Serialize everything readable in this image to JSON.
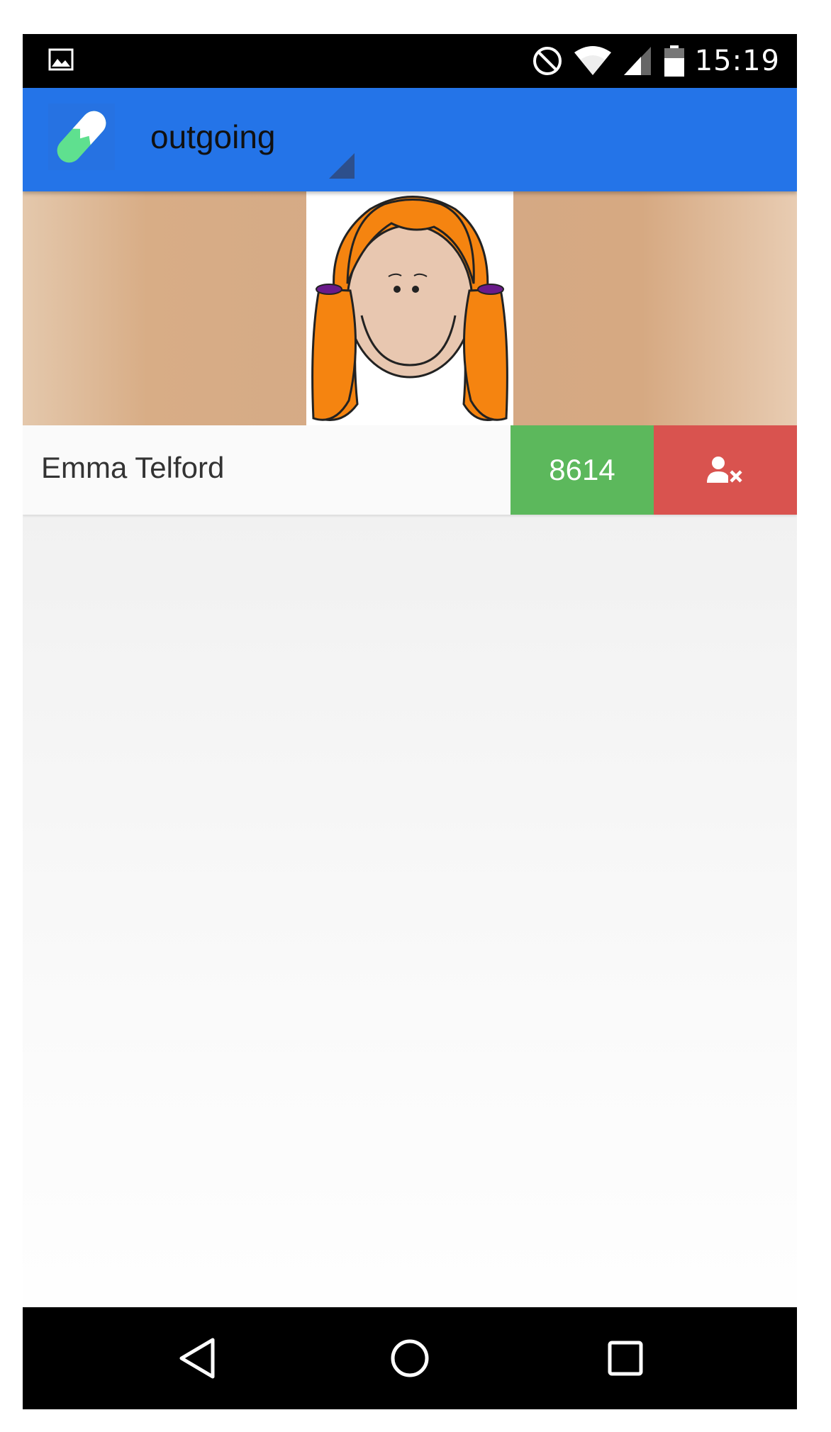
{
  "status_bar": {
    "time": "15:19",
    "icons": [
      "gallery-icon",
      "do-not-disturb-icon",
      "wifi-icon",
      "cell-signal-icon",
      "battery-icon"
    ]
  },
  "app_bar": {
    "title": "outgoing",
    "logo": "pill-logo-icon",
    "color": "#2474e8"
  },
  "contact": {
    "name": "Emma Telford",
    "number": "8614",
    "remove_icon": "user-remove-icon",
    "number_color": "#5cb85c",
    "remove_color": "#d9534f"
  },
  "nav_bar": {
    "buttons": [
      "back-icon",
      "home-icon",
      "recents-icon"
    ]
  }
}
